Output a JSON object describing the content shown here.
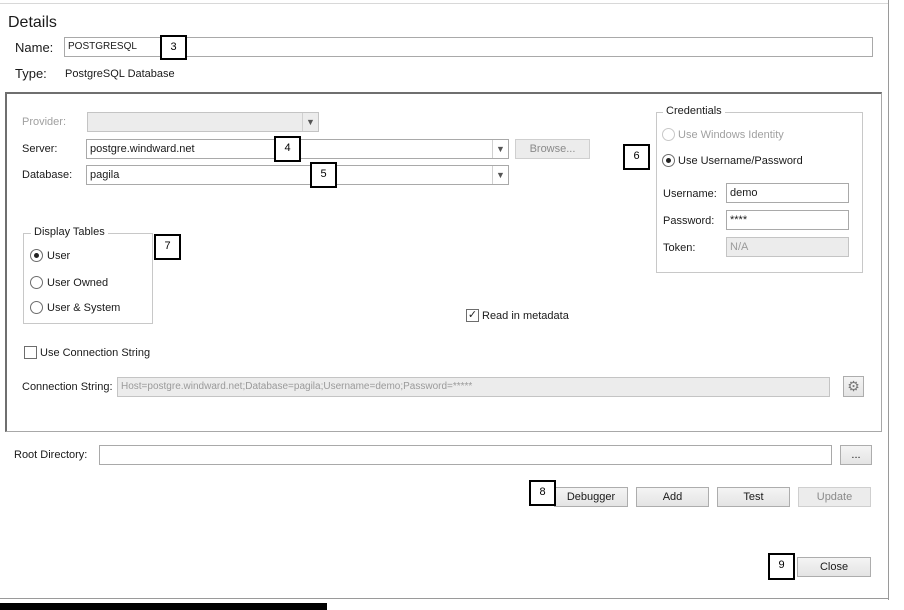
{
  "details": {
    "heading": "Details",
    "name_label": "Name:",
    "name_value": "POSTGRESQL",
    "type_label": "Type:",
    "type_value": "PostgreSQL Database"
  },
  "connection": {
    "provider_label": "Provider:",
    "provider_value": "",
    "server_label": "Server:",
    "server_value": "postgre.windward.net",
    "browse_label": "Browse...",
    "database_label": "Database:",
    "database_value": "pagila"
  },
  "credentials": {
    "title": "Credentials",
    "windows_identity_label": "Use Windows Identity",
    "username_password_label": "Use Username/Password",
    "selected": "Use Username/Password",
    "username_label": "Username:",
    "username_value": "demo",
    "password_label": "Password:",
    "password_value": "****",
    "token_label": "Token:",
    "token_value": "N/A"
  },
  "display_tables": {
    "title": "Display Tables",
    "options": [
      "User",
      "User Owned",
      "User & System"
    ],
    "selected": "User"
  },
  "read_metadata": {
    "label": "Read in metadata",
    "checked": true
  },
  "use_connection_string": {
    "label": "Use Connection String",
    "checked": false
  },
  "connection_string": {
    "label": "Connection String:",
    "value": "Host=postgre.windward.net;Database=pagila;Username=demo;Password=*****"
  },
  "root_directory": {
    "label": "Root Directory:",
    "value": "",
    "browse_label": "..."
  },
  "buttons": {
    "debugger": "Debugger",
    "add": "Add",
    "test": "Test",
    "update": "Update",
    "close": "Close"
  },
  "callouts": [
    "3",
    "4",
    "5",
    "6",
    "7",
    "8",
    "9"
  ],
  "icons": {
    "dropdown": "chevron-down-icon",
    "settings": "gear-icon",
    "checkmark": "checkmark-icon"
  }
}
